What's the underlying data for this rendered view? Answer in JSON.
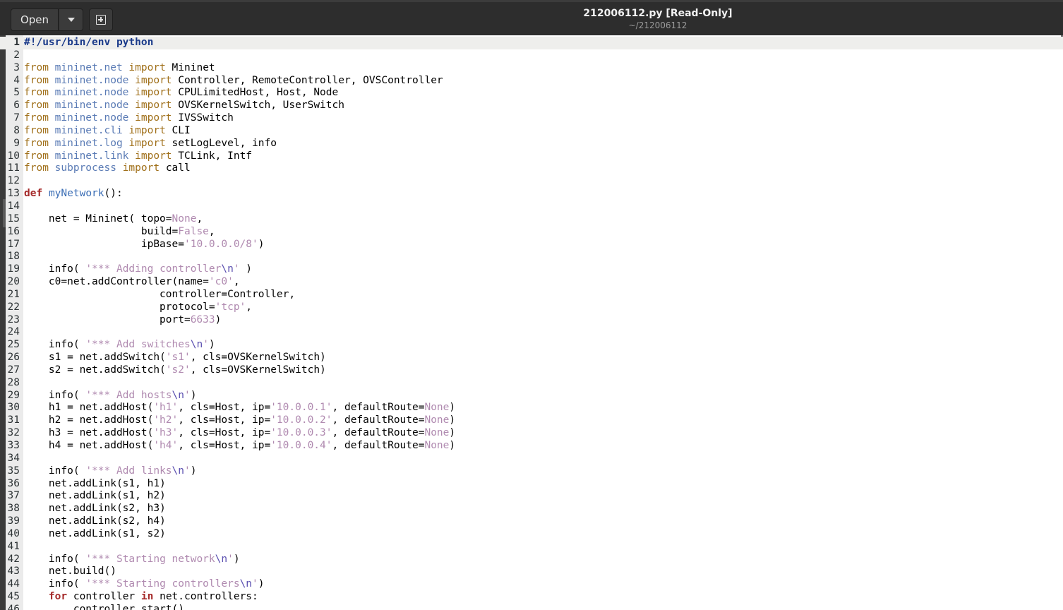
{
  "toolbar": {
    "open_label": "Open"
  },
  "window": {
    "title": "212006112.py [Read-Only]",
    "subtitle": "~/212006112"
  },
  "editor": {
    "current_line": 1,
    "lines": [
      "#!/usr/bin/env python",
      "",
      "from mininet.net import Mininet",
      "from mininet.node import Controller, RemoteController, OVSController",
      "from mininet.node import CPULimitedHost, Host, Node",
      "from mininet.node import OVSKernelSwitch, UserSwitch",
      "from mininet.node import IVSSwitch",
      "from mininet.cli import CLI",
      "from mininet.log import setLogLevel, info",
      "from mininet.link import TCLink, Intf",
      "from subprocess import call",
      "",
      "def myNetwork():",
      "",
      "    net = Mininet( topo=None,",
      "                   build=False,",
      "                   ipBase='10.0.0.0/8')",
      "",
      "    info( '*** Adding controller\\n' )",
      "    c0=net.addController(name='c0',",
      "                      controller=Controller,",
      "                      protocol='tcp',",
      "                      port=6633)",
      "",
      "    info( '*** Add switches\\n')",
      "    s1 = net.addSwitch('s1', cls=OVSKernelSwitch)",
      "    s2 = net.addSwitch('s2', cls=OVSKernelSwitch)",
      "",
      "    info( '*** Add hosts\\n')",
      "    h1 = net.addHost('h1', cls=Host, ip='10.0.0.1', defaultRoute=None)",
      "    h2 = net.addHost('h2', cls=Host, ip='10.0.0.2', defaultRoute=None)",
      "    h3 = net.addHost('h3', cls=Host, ip='10.0.0.3', defaultRoute=None)",
      "    h4 = net.addHost('h4', cls=Host, ip='10.0.0.4', defaultRoute=None)",
      "",
      "    info( '*** Add links\\n')",
      "    net.addLink(s1, h1)",
      "    net.addLink(s1, h2)",
      "    net.addLink(s2, h3)",
      "    net.addLink(s2, h4)",
      "    net.addLink(s1, s2)",
      "",
      "    info( '*** Starting network\\n')",
      "    net.build()",
      "    info( '*** Starting controllers\\n')",
      "    for controller in net.controllers:",
      "        controller.start()"
    ]
  },
  "colors": {
    "titlebar_bg": "#2d2d2d",
    "keyword": "#a52a2a",
    "module": "#5a7bb5",
    "string": "#b08ab0",
    "import": "#a0701a"
  }
}
